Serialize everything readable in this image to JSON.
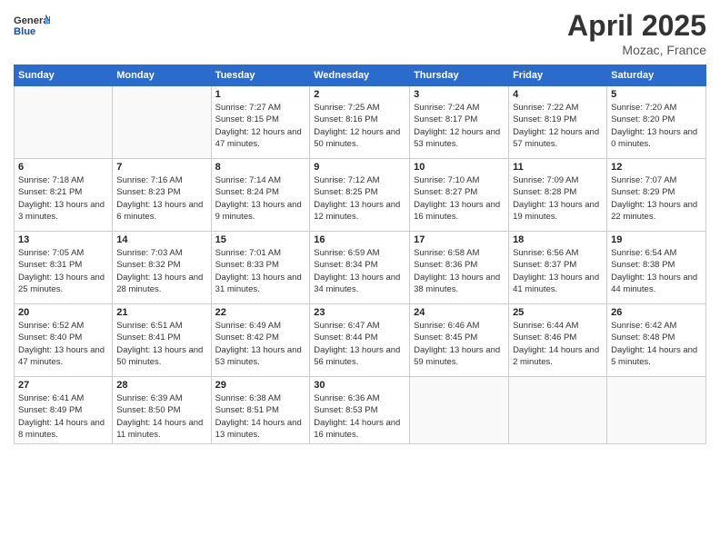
{
  "header": {
    "logo_general": "General",
    "logo_blue": "Blue",
    "month_title": "April 2025",
    "location": "Mozac, France"
  },
  "days_of_week": [
    "Sunday",
    "Monday",
    "Tuesday",
    "Wednesday",
    "Thursday",
    "Friday",
    "Saturday"
  ],
  "weeks": [
    [
      {
        "day": "",
        "info": ""
      },
      {
        "day": "",
        "info": ""
      },
      {
        "day": "1",
        "info": "Sunrise: 7:27 AM\nSunset: 8:15 PM\nDaylight: 12 hours and 47 minutes."
      },
      {
        "day": "2",
        "info": "Sunrise: 7:25 AM\nSunset: 8:16 PM\nDaylight: 12 hours and 50 minutes."
      },
      {
        "day": "3",
        "info": "Sunrise: 7:24 AM\nSunset: 8:17 PM\nDaylight: 12 hours and 53 minutes."
      },
      {
        "day": "4",
        "info": "Sunrise: 7:22 AM\nSunset: 8:19 PM\nDaylight: 12 hours and 57 minutes."
      },
      {
        "day": "5",
        "info": "Sunrise: 7:20 AM\nSunset: 8:20 PM\nDaylight: 13 hours and 0 minutes."
      }
    ],
    [
      {
        "day": "6",
        "info": "Sunrise: 7:18 AM\nSunset: 8:21 PM\nDaylight: 13 hours and 3 minutes."
      },
      {
        "day": "7",
        "info": "Sunrise: 7:16 AM\nSunset: 8:23 PM\nDaylight: 13 hours and 6 minutes."
      },
      {
        "day": "8",
        "info": "Sunrise: 7:14 AM\nSunset: 8:24 PM\nDaylight: 13 hours and 9 minutes."
      },
      {
        "day": "9",
        "info": "Sunrise: 7:12 AM\nSunset: 8:25 PM\nDaylight: 13 hours and 12 minutes."
      },
      {
        "day": "10",
        "info": "Sunrise: 7:10 AM\nSunset: 8:27 PM\nDaylight: 13 hours and 16 minutes."
      },
      {
        "day": "11",
        "info": "Sunrise: 7:09 AM\nSunset: 8:28 PM\nDaylight: 13 hours and 19 minutes."
      },
      {
        "day": "12",
        "info": "Sunrise: 7:07 AM\nSunset: 8:29 PM\nDaylight: 13 hours and 22 minutes."
      }
    ],
    [
      {
        "day": "13",
        "info": "Sunrise: 7:05 AM\nSunset: 8:31 PM\nDaylight: 13 hours and 25 minutes."
      },
      {
        "day": "14",
        "info": "Sunrise: 7:03 AM\nSunset: 8:32 PM\nDaylight: 13 hours and 28 minutes."
      },
      {
        "day": "15",
        "info": "Sunrise: 7:01 AM\nSunset: 8:33 PM\nDaylight: 13 hours and 31 minutes."
      },
      {
        "day": "16",
        "info": "Sunrise: 6:59 AM\nSunset: 8:34 PM\nDaylight: 13 hours and 34 minutes."
      },
      {
        "day": "17",
        "info": "Sunrise: 6:58 AM\nSunset: 8:36 PM\nDaylight: 13 hours and 38 minutes."
      },
      {
        "day": "18",
        "info": "Sunrise: 6:56 AM\nSunset: 8:37 PM\nDaylight: 13 hours and 41 minutes."
      },
      {
        "day": "19",
        "info": "Sunrise: 6:54 AM\nSunset: 8:38 PM\nDaylight: 13 hours and 44 minutes."
      }
    ],
    [
      {
        "day": "20",
        "info": "Sunrise: 6:52 AM\nSunset: 8:40 PM\nDaylight: 13 hours and 47 minutes."
      },
      {
        "day": "21",
        "info": "Sunrise: 6:51 AM\nSunset: 8:41 PM\nDaylight: 13 hours and 50 minutes."
      },
      {
        "day": "22",
        "info": "Sunrise: 6:49 AM\nSunset: 8:42 PM\nDaylight: 13 hours and 53 minutes."
      },
      {
        "day": "23",
        "info": "Sunrise: 6:47 AM\nSunset: 8:44 PM\nDaylight: 13 hours and 56 minutes."
      },
      {
        "day": "24",
        "info": "Sunrise: 6:46 AM\nSunset: 8:45 PM\nDaylight: 13 hours and 59 minutes."
      },
      {
        "day": "25",
        "info": "Sunrise: 6:44 AM\nSunset: 8:46 PM\nDaylight: 14 hours and 2 minutes."
      },
      {
        "day": "26",
        "info": "Sunrise: 6:42 AM\nSunset: 8:48 PM\nDaylight: 14 hours and 5 minutes."
      }
    ],
    [
      {
        "day": "27",
        "info": "Sunrise: 6:41 AM\nSunset: 8:49 PM\nDaylight: 14 hours and 8 minutes."
      },
      {
        "day": "28",
        "info": "Sunrise: 6:39 AM\nSunset: 8:50 PM\nDaylight: 14 hours and 11 minutes."
      },
      {
        "day": "29",
        "info": "Sunrise: 6:38 AM\nSunset: 8:51 PM\nDaylight: 14 hours and 13 minutes."
      },
      {
        "day": "30",
        "info": "Sunrise: 6:36 AM\nSunset: 8:53 PM\nDaylight: 14 hours and 16 minutes."
      },
      {
        "day": "",
        "info": ""
      },
      {
        "day": "",
        "info": ""
      },
      {
        "day": "",
        "info": ""
      }
    ]
  ]
}
